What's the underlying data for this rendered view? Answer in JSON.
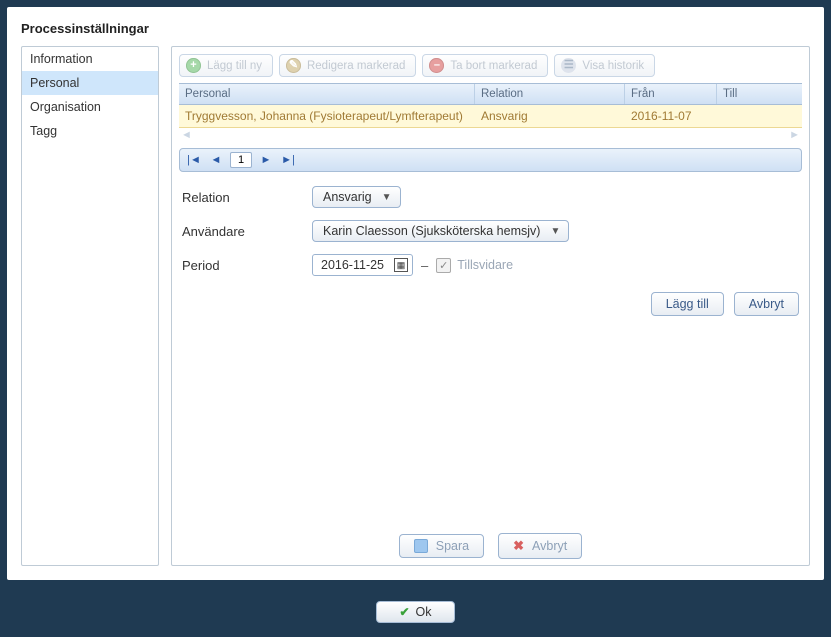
{
  "dialog": {
    "title": "Processinställningar"
  },
  "sidebar": {
    "items": [
      {
        "label": "Information",
        "selected": false
      },
      {
        "label": "Personal",
        "selected": true
      },
      {
        "label": "Organisation",
        "selected": false
      },
      {
        "label": "Tagg",
        "selected": false
      }
    ]
  },
  "toolbar": {
    "add": "Lägg till ny",
    "edit": "Redigera markerad",
    "delete": "Ta bort markerad",
    "history": "Visa historik"
  },
  "grid": {
    "headers": {
      "personal": "Personal",
      "relation": "Relation",
      "from": "Från",
      "to": "Till"
    },
    "rows": [
      {
        "personal": "Tryggvesson, Johanna (Fysioterapeut/Lymfterapeut)",
        "relation": "Ansvarig",
        "from": "2016-11-07",
        "to": ""
      }
    ]
  },
  "pager": {
    "current": "1"
  },
  "form": {
    "relation_label": "Relation",
    "relation_value": "Ansvarig",
    "user_label": "Användare",
    "user_value": "Karin Claesson (Sjuksköterska hemsjv)",
    "period_label": "Period",
    "period_from": "2016-11-25",
    "tills_label": "Tillsvidare"
  },
  "actions": {
    "add": "Lägg till",
    "cancel": "Avbryt"
  },
  "footer": {
    "save": "Spara",
    "cancel": "Avbryt"
  },
  "ok": {
    "label": "Ok"
  }
}
